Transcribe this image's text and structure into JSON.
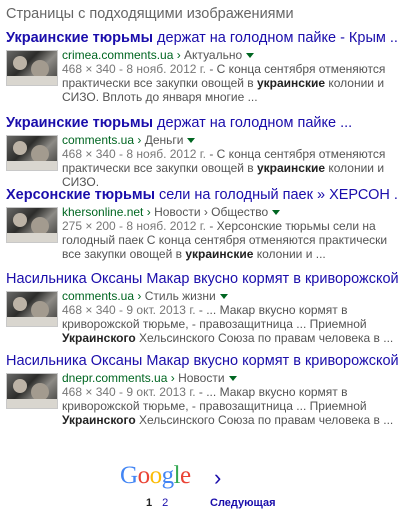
{
  "heading": "Страницы с подходящими изображениями",
  "results": [
    {
      "title_bold": "Украинские тюрьмы",
      "title_rest": " держат на голодном пайке - Крым ...",
      "url": "crimea.comments.ua",
      "crumb": "Актуально",
      "meta": "468 × 340 - 8 нояб. 2012 г.",
      "snip1": " - С конца сентября отменяются практически все закупки овощей в ",
      "snip_bold": "украинские",
      "snip2": " колонии и СИЗО. Вплоть до января многие ..."
    },
    {
      "title_bold": "Украинские тюрьмы",
      "title_rest": " держат на голодном пайке ...",
      "url": "comments.ua",
      "crumb": "Деньги",
      "meta": "468 × 340 - 8 нояб. 2012 г.",
      "snip1": " - С конца сентября отменяются практически все закупки овощей в ",
      "snip_bold": "украинские",
      "snip2": " колонии и СИЗО."
    },
    {
      "title_bold": "Херсонские тюрьмы",
      "title_rest": " сели на голодный паек » ХЕРСОН ...",
      "url": "khersonline.net",
      "crumb": "Новости › Общество",
      "meta": "275 × 200 - 8 нояб. 2012 г.",
      "snip1": " - Херсонские тюрьмы сели на голодный паек С конца сентября отменяются практически все закупки овощей в ",
      "snip_bold": "украинские",
      "snip2": " колонии и ..."
    },
    {
      "title_bold": "",
      "title_rest": "Насильника Оксаны Макар вкусно кормят в криворожской ...",
      "url": "comments.ua",
      "crumb": "Стиль жизни",
      "meta": "468 × 340 - 9 окт. 2013 г.",
      "snip1": " - ... Макар вкусно кормят в криворожской тюрьме, - правозащитница ... Приемной ",
      "snip_bold": "Украинского",
      "snip2": " Хельсинского Союза по правам человека в ..."
    },
    {
      "title_bold": "",
      "title_rest": "Насильника Оксаны Макар вкусно кормят в криворожской ...",
      "url": "dnepr.comments.ua",
      "crumb": "Новости",
      "meta": "468 × 340 - 9 окт. 2013 г.",
      "snip1": " - ... Макар вкусно кормят в криворожской тюрьме, - правозащитница ... Приемной ",
      "snip_bold": "Украинского",
      "snip2": " Хельсинского Союза по правам человека в ..."
    }
  ],
  "footer": {
    "logo": [
      "G",
      "o",
      "o",
      "g",
      "l",
      "e"
    ],
    "arrow": "›",
    "page_current": "1",
    "page_2": "2",
    "next": "Следующая"
  },
  "colors": {
    "link": "#1a0dab",
    "url": "#006621",
    "snippet": "#545454"
  }
}
